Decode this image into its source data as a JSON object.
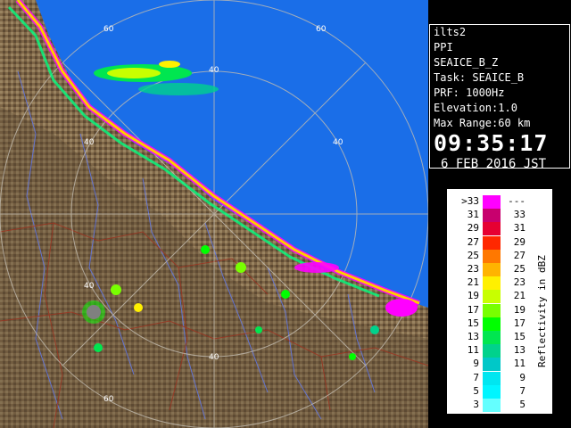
{
  "radar": {
    "range_labels": [
      "60",
      "60",
      "40",
      "40",
      "40",
      "40",
      "40",
      "60"
    ],
    "colors": {
      "sea": "#1a6ee8",
      "land": "#7e6647",
      "ring": "#b9b2a6",
      "border": "#8a2d1b",
      "river": "#5a6fd6"
    }
  },
  "info": {
    "station": "ilts2",
    "mode": "PPI",
    "product": "SEAICE_B_Z",
    "task": "Task: SEAICE_B",
    "prf": "PRF: 1000Hz",
    "elevation": "Elevation:1.0",
    "max_range": "Max Range:60 km",
    "time": "09:35:17",
    "date": "6 FEB 2016 JST"
  },
  "legend": {
    "unit_label": "Reflectivity in dBZ",
    "rows": [
      {
        "lo": ">33",
        "hi": "---",
        "color": "#ff00ff"
      },
      {
        "lo": "31",
        "hi": "33",
        "color": "#c8006e"
      },
      {
        "lo": "29",
        "hi": "31",
        "color": "#e60032"
      },
      {
        "lo": "27",
        "hi": "29",
        "color": "#ff2800"
      },
      {
        "lo": "25",
        "hi": "27",
        "color": "#ff7800"
      },
      {
        "lo": "23",
        "hi": "25",
        "color": "#ffb400"
      },
      {
        "lo": "21",
        "hi": "23",
        "color": "#fff000"
      },
      {
        "lo": "19",
        "hi": "21",
        "color": "#c8ff00"
      },
      {
        "lo": "17",
        "hi": "19",
        "color": "#78ff00"
      },
      {
        "lo": "15",
        "hi": "17",
        "color": "#00ff00"
      },
      {
        "lo": "13",
        "hi": "15",
        "color": "#00e650"
      },
      {
        "lo": "11",
        "hi": "13",
        "color": "#00d28c"
      },
      {
        "lo": "9",
        "hi": "11",
        "color": "#00c8c8"
      },
      {
        "lo": "7",
        "hi": "9",
        "color": "#00e6f0"
      },
      {
        "lo": "5",
        "hi": "7",
        "color": "#00f5ff"
      },
      {
        "lo": "3",
        "hi": "5",
        "color": "#64ffff"
      }
    ]
  }
}
